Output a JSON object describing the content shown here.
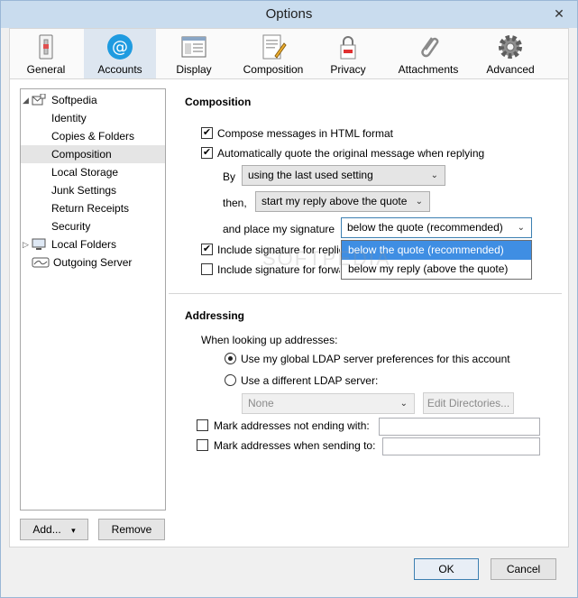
{
  "window": {
    "title": "Options",
    "close_glyph": "✕"
  },
  "toolbar": {
    "items": [
      {
        "label": "General",
        "icon": "general-icon"
      },
      {
        "label": "Accounts",
        "icon": "accounts-icon"
      },
      {
        "label": "Display",
        "icon": "display-icon"
      },
      {
        "label": "Composition",
        "icon": "composition-icon"
      },
      {
        "label": "Privacy",
        "icon": "privacy-icon"
      },
      {
        "label": "Attachments",
        "icon": "attachments-icon"
      },
      {
        "label": "Advanced",
        "icon": "advanced-icon"
      }
    ],
    "selected": "Accounts"
  },
  "tree": {
    "items": [
      {
        "label": "Softpedia"
      },
      {
        "label": "Identity"
      },
      {
        "label": "Copies & Folders"
      },
      {
        "label": "Composition"
      },
      {
        "label": "Local Storage"
      },
      {
        "label": "Junk Settings"
      },
      {
        "label": "Return Receipts"
      },
      {
        "label": "Security"
      },
      {
        "label": "Local Folders"
      },
      {
        "label": "Outgoing Server"
      }
    ],
    "selected": "Composition"
  },
  "tree_buttons": {
    "add": "Add...",
    "add_arrow": "▾",
    "remove": "Remove"
  },
  "composition": {
    "title": "Composition",
    "html_label": "Compose messages in HTML format",
    "quote_label": "Automatically quote the original message when replying",
    "by_label": "By",
    "by_value": "using the last used setting",
    "then_label": "then,",
    "then_value": "start my reply above the quote",
    "sig_label": "and place my signature",
    "sig_value": "below the quote (recommended)",
    "sig_options": [
      "below the quote (recommended)",
      "below my reply (above the quote)"
    ],
    "inc_reply_label": "Include signature for replies",
    "inc_fwd_label": "Include signature for forwards",
    "chevron": "⌄"
  },
  "addressing": {
    "title": "Addressing",
    "lookup_label": "When looking up addresses:",
    "global_label": "Use my global LDAP server preferences for this account",
    "different_label": "Use a different LDAP server:",
    "ldap_value": "None",
    "edit_dirs": "Edit Directories...",
    "mark_not_ending": "Mark addresses not ending with:",
    "mark_sending": "Mark addresses when sending to:"
  },
  "footer": {
    "ok": "OK",
    "cancel": "Cancel"
  },
  "watermark": "SOFTPEDIA",
  "colors": {
    "selection": "#3f8ee3",
    "titlebar": "#c9dcee"
  }
}
